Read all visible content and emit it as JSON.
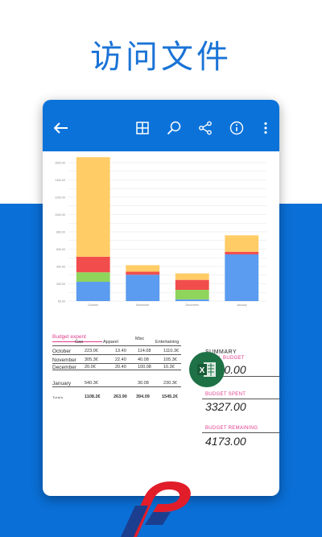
{
  "hero": {
    "title": "访问文件"
  },
  "toolbar": {
    "icons": [
      "back-arrow-icon",
      "grid-icon",
      "search-icon",
      "share-icon",
      "info-icon",
      "more-vertical-icon"
    ]
  },
  "colors": {
    "brand_blue": "#0a6fd6",
    "appbar_blue": "#0b72d9",
    "accent_pink": "#e03a8c",
    "excel_green": "#1e7145",
    "series_blue": "#5b9bf0",
    "series_green": "#8fd45b",
    "series_red": "#f24d4d",
    "series_yellow": "#ffcc66"
  },
  "chart_data": {
    "type": "bar",
    "stacked": true,
    "categories": [
      "October",
      "November",
      "December",
      "January"
    ],
    "series": [
      {
        "name": "",
        "color": "#5b9bf0",
        "values": [
          223,
          305,
          20,
          540
        ]
      },
      {
        "name": "",
        "color": "#8fd45b",
        "values": [
          110,
          0,
          110,
          0
        ]
      },
      {
        "name": "",
        "color": "#f24d4d",
        "values": [
          180,
          35,
          115,
          30
        ]
      },
      {
        "name": "",
        "color": "#ffcc66",
        "values": [
          1150,
          75,
          75,
          190
        ]
      }
    ],
    "y_ticks": [
      "1600.00",
      "1400.00",
      "1200.00",
      "1000.00",
      "800.00",
      "600.00",
      "400.00",
      "200.00",
      "50.00"
    ],
    "ylim": [
      0,
      1600
    ],
    "grid": true
  },
  "sheet": {
    "title": "Budget expent",
    "headers": [
      "Gas",
      "Apparel",
      "Misc",
      "Entertaining"
    ],
    "rows": [
      {
        "month": "October",
        "values": [
          "223.0€",
          "13.40",
          "114.08",
          "1110.3€"
        ]
      },
      {
        "month": "November",
        "values": [
          "305.3€",
          "22.40",
          "40.08",
          "105.3€"
        ]
      },
      {
        "month": "December",
        "values": [
          "20.0€",
          "20.40",
          "100.08",
          "10.3€"
        ]
      },
      {
        "month": "January",
        "values": [
          "540.3€",
          "",
          "30.08",
          "230.3€"
        ]
      }
    ],
    "totals_label": "Totals",
    "totals": [
      "1108.2€",
      "263.90",
      "394.09",
      "1545.2€"
    ],
    "summary": {
      "heading": "SUMMARY",
      "total_label": "TOTAL BUDGET",
      "total_value": "7500.00",
      "spent_label": "BUDGET SPENT",
      "spent_value": "3327.00",
      "remaining_label": "BUDGET REMAINING",
      "remaining_value": "4173.00"
    }
  },
  "excel_badge": {
    "letter": "X"
  }
}
